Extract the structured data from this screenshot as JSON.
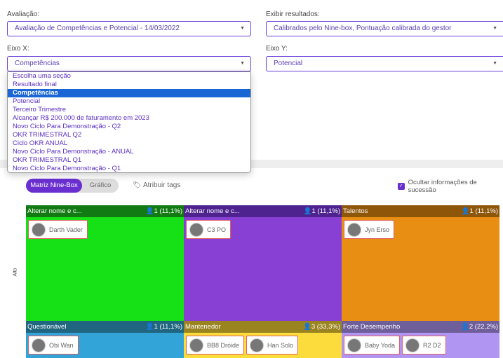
{
  "filters": {
    "avaliacao_label": "Avaliação:",
    "avaliacao_value": "Avaliação de Competências e Potencial - 14/03/2022",
    "exibir_label": "Exibir resultados:",
    "exibir_value": "Calibrados pelo Nine-box, Pontuação calibrada do gestor",
    "eixo_x_label": "Eixo X:",
    "eixo_x_value": "Competências",
    "eixo_y_label": "Eixo Y:",
    "eixo_y_value": "Potencial"
  },
  "dropdown": {
    "options": [
      "Escolha uma seção",
      "Resultado final",
      "Competências",
      "Potencial",
      "Terceiro Trimestre",
      "Alcançar R$ 200.000 de faturamento em 2023",
      "Novo Ciclo Para Demonstração - Q2",
      "OKR TRIMESTRAL Q2",
      "Ciclo OKR ANUAL",
      "Novo Ciclo Para Demonstração - ANUAL",
      "OKR TRIMESTRAL Q1",
      "Novo Ciclo Para Demonstração - Q1"
    ],
    "selected": "Competências"
  },
  "view": {
    "tab_matrix": "Matriz Nine-Box",
    "tab_chart": "Gráfico",
    "assign_tags": "Atribuir tags",
    "hide_succession": "Ocultar informações de sucessão",
    "y_axis_label": "Alto"
  },
  "grid": [
    {
      "title": "Alterar nome e c...",
      "count": "1 (11,1%)",
      "header": "#127a12",
      "body": "#16e016",
      "people": [
        "Darth Vader"
      ]
    },
    {
      "title": "Alterar nome e c...",
      "count": "1 (11,1%)",
      "header": "#4e2390",
      "body": "#8840d4",
      "people": [
        "C3 PO"
      ]
    },
    {
      "title": "Talentos",
      "count": "1 (11,1%)",
      "header": "#8e5608",
      "body": "#e88e12",
      "people": [
        "Jyn Erso"
      ]
    },
    {
      "title": "Questionável",
      "count": "1 (11,1%)",
      "header": "#216680",
      "body": "#33a4d8",
      "people": [
        "Obi Wan"
      ]
    },
    {
      "title": "Mantenedor",
      "count": "3 (33,3%)",
      "header": "#9a8420",
      "body": "#fcdc3c",
      "people": [
        "BB8 Dróide",
        "Han Solo"
      ]
    },
    {
      "title": "Forte Desempenho",
      "count": "2 (22,2%)",
      "header": "#6e5e9a",
      "body": "#b096f2",
      "people": [
        "Baby Yoda",
        "R2 D2"
      ]
    }
  ]
}
